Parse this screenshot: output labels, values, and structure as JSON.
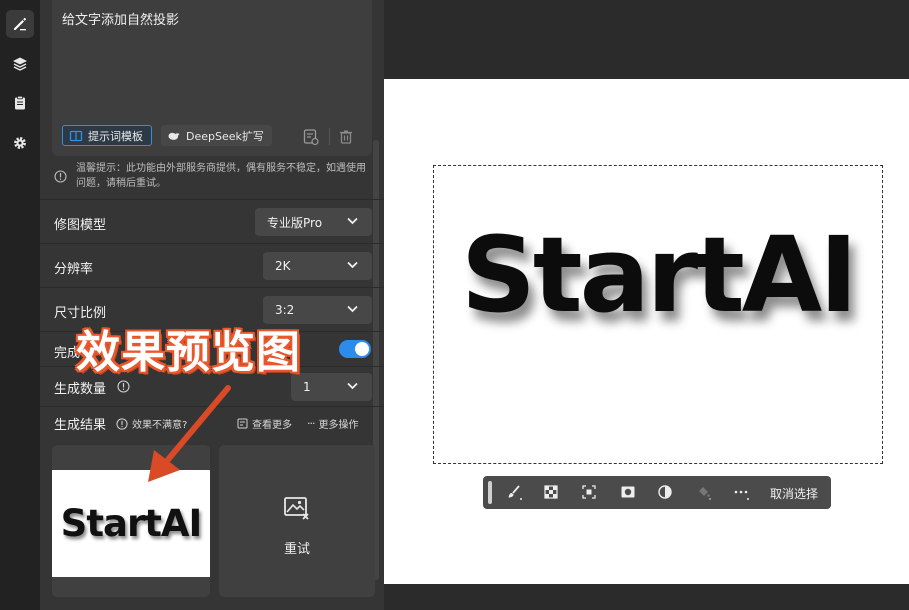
{
  "rail": {
    "items": [
      {
        "name": "edit",
        "icon": "pencil-icon"
      },
      {
        "name": "layers",
        "icon": "layers-icon"
      },
      {
        "name": "clipboard",
        "icon": "clipboard-icon"
      },
      {
        "name": "settings",
        "icon": "gear-icon"
      }
    ]
  },
  "prompt": {
    "text": "给文字添加自然投影",
    "template_button": "提示词模板",
    "deepseek_button": "DeepSeek扩写"
  },
  "tip": {
    "text": "温馨提示：此功能由外部服务商提供，偶有服务不稳定，如遇使用问题，请稍后重试。"
  },
  "settings": {
    "model_label": "修图模型",
    "model_value": "专业版Pro",
    "resolution_label": "分辨率",
    "resolution_value": "2K",
    "ratio_label": "尺寸比例",
    "ratio_value": "3:2",
    "complete_label": "完成",
    "count_label": "生成数量",
    "count_value": "1"
  },
  "results": {
    "label": "生成结果",
    "unsatisfied": "效果不满意?",
    "view_more": "查看更多",
    "more_actions": "更多操作",
    "thumb_text": "StartAI",
    "retry_label": "重试"
  },
  "canvas": {
    "text": "StartAI"
  },
  "toolbar": {
    "cancel_selection": "取消选择"
  },
  "annotation": {
    "text": "效果预览图",
    "color": "#e8582c"
  },
  "colors": {
    "accent": "#2d8ceb",
    "panel": "#353535"
  }
}
